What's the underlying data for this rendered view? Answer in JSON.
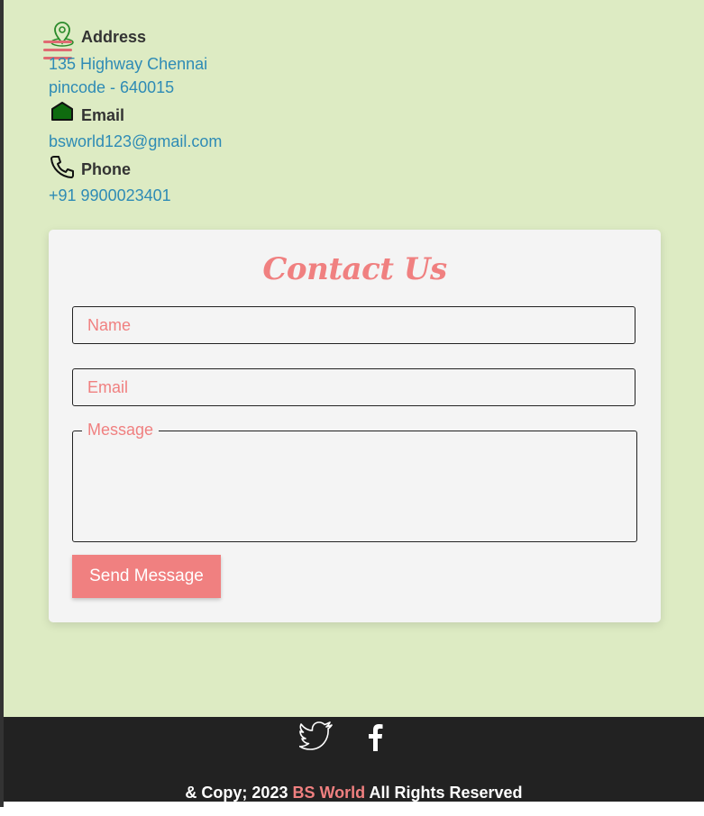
{
  "menu": {
    "icon": "hamburger-menu-icon"
  },
  "contact_info": {
    "address": {
      "icon": "location-pin-icon",
      "title": "Address",
      "lines": [
        "135 Highway Chennai",
        "pincode - 640015"
      ]
    },
    "email": {
      "icon": "home-icon",
      "title": "Email",
      "value": "bsworld123@gmail.com"
    },
    "phone": {
      "icon": "phone-icon",
      "title": "Phone",
      "value": "+91 9900023401"
    }
  },
  "form": {
    "title": "Contact Us",
    "name_placeholder": "Name",
    "email_placeholder": "Email",
    "message_label": "Message",
    "submit_label": "Send Message"
  },
  "footer": {
    "social": [
      "twitter-icon",
      "facebook-icon"
    ],
    "copyright_prefix": "& Copy; 2023",
    "brand": "BS World",
    "copyright_suffix": "All Rights Reserved"
  },
  "colors": {
    "background": "#ddebc3",
    "accent": "#f08080",
    "link": "#2e8bb5",
    "footer": "#222222",
    "card": "#f4f4f4"
  }
}
